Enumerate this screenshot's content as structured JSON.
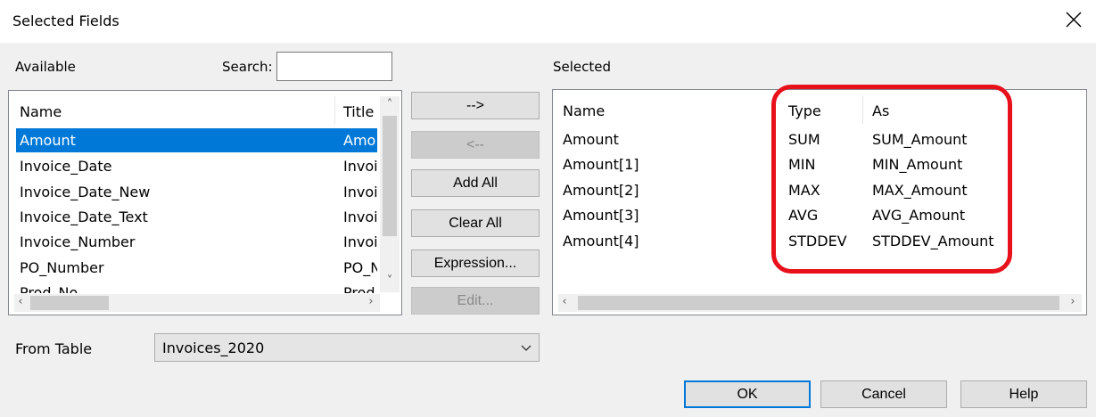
{
  "window": {
    "title": "Selected Fields"
  },
  "available": {
    "label": "Available",
    "search_label": "Search:",
    "search_value": "",
    "columns": [
      "Name",
      "Title"
    ],
    "rows": [
      {
        "name": "Amount",
        "title": "Amo"
      },
      {
        "name": "Invoice_Date",
        "title": "Invoi"
      },
      {
        "name": "Invoice_Date_New",
        "title": "Invoi"
      },
      {
        "name": "Invoice_Date_Text",
        "title": "Invoi"
      },
      {
        "name": "Invoice_Number",
        "title": "Invoi"
      },
      {
        "name": "PO_Number",
        "title": "PO_N"
      },
      {
        "name": "Prod_No",
        "title": "Prod"
      }
    ]
  },
  "buttons": {
    "add": "-->",
    "remove": "<--",
    "add_all": "Add All",
    "clear_all": "Clear All",
    "expression": "Expression...",
    "edit": "Edit...",
    "ok": "OK",
    "cancel": "Cancel",
    "help": "Help"
  },
  "selected": {
    "label": "Selected",
    "columns": [
      "Name",
      "Type",
      "As"
    ],
    "rows": [
      {
        "name": "Amount",
        "type": "SUM",
        "as": "SUM_Amount"
      },
      {
        "name": "Amount[1]",
        "type": "MIN",
        "as": "MIN_Amount"
      },
      {
        "name": "Amount[2]",
        "type": "MAX",
        "as": "MAX_Amount"
      },
      {
        "name": "Amount[3]",
        "type": "AVG",
        "as": "AVG_Amount"
      },
      {
        "name": "Amount[4]",
        "type": "STDDEV",
        "as": "STDDEV_Amount"
      }
    ]
  },
  "from_table": {
    "label": "From Table",
    "value": "Invoices_2020"
  },
  "colors": {
    "selection": "#0078d7",
    "highlight_box": "#e8101b",
    "default_button_border": "#0078d7"
  }
}
